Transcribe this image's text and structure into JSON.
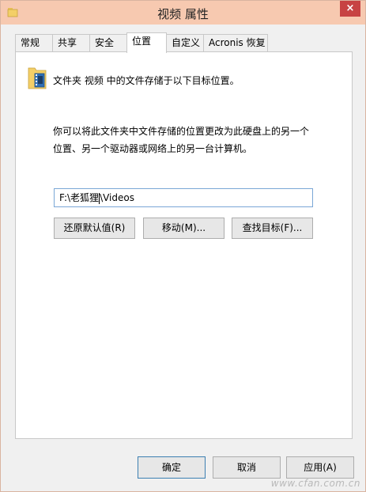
{
  "window": {
    "title": "视频 属性",
    "close_glyph": "×"
  },
  "tabs": [
    {
      "label": "常规"
    },
    {
      "label": "共享"
    },
    {
      "label": "安全"
    },
    {
      "label": "位置",
      "active": true
    },
    {
      "label": "自定义"
    },
    {
      "label": "Acronis 恢复"
    }
  ],
  "location": {
    "intro": "文件夹 视频 中的文件存储于以下目标位置。",
    "description_line1": "你可以将此文件夹中文件存储的位置更改为此硬盘上的另一个",
    "description_line2": "位置、另一个驱动器或网络上的另一台计算机。",
    "path_before_caret": "F:\\老狐狸",
    "path_after_caret": "\\Videos",
    "restore_default_label": "还原默认值(R)",
    "move_label": "移动(M)...",
    "find_target_label": "查找目标(F)..."
  },
  "footer": {
    "ok_label": "确定",
    "cancel_label": "取消",
    "apply_label": "应用(A)"
  },
  "watermark": {
    "text": "www.cfan.com.cn"
  },
  "icons": {
    "title": "folder-icon",
    "content": "videos-folder-icon"
  },
  "colors": {
    "titlebar": "#f7c9b0",
    "close_button": "#c74343",
    "input_border": "#7aa7d6"
  }
}
